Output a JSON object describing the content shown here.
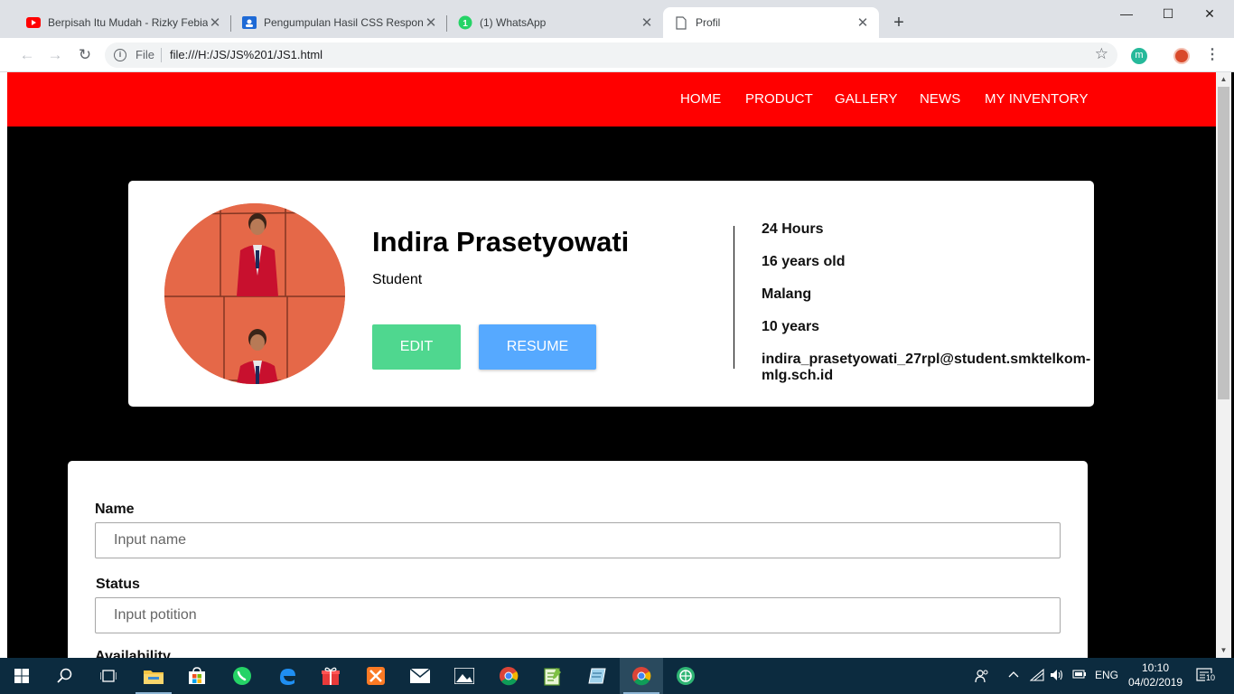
{
  "browser": {
    "tabs": [
      {
        "title": "Berpisah Itu Mudah - Rizky Febian",
        "icon": "youtube-icon"
      },
      {
        "title": "Pengumpulan Hasil CSS Responsi",
        "icon": "classroom-icon"
      },
      {
        "title": "(1) WhatsApp",
        "icon": "whatsapp-icon"
      },
      {
        "title": "Profil",
        "icon": "page-icon"
      }
    ],
    "close_glyph": "✕",
    "new_tab_glyph": "+",
    "window_controls": {
      "minimize": "—",
      "maximize": "☐",
      "close": "✕"
    },
    "address": {
      "scheme_label": "File",
      "url": "file:///H:/JS/JS%201/JS1.html"
    },
    "extension_initial": "m"
  },
  "navbar": {
    "links": [
      "HOME",
      "PRODUCT",
      "GALLERY",
      "NEWS",
      "MY INVENTORY"
    ],
    "color": "#ff0000"
  },
  "profile": {
    "name": "Indira Prasetyowati",
    "role": "Student",
    "edit_label": "EDIT",
    "resume_label": "RESUME",
    "details": [
      "24 Hours",
      "16 years old",
      "Malang",
      "10 years",
      "indira_prasetyowati_27rpl@student.smktelkom-",
      "mlg.sch.id"
    ]
  },
  "form": {
    "fields": [
      {
        "label": "Name",
        "placeholder": "Input name"
      },
      {
        "label": "Status",
        "placeholder": "Input potition"
      },
      {
        "label": "Availability"
      }
    ]
  },
  "taskbar": {
    "apps": [
      "start-icon",
      "search-icon",
      "task-view-icon",
      "file-explorer-icon",
      "store-icon",
      "whatsapp-icon",
      "edge-icon",
      "gift-icon",
      "xampp-icon",
      "mail-icon",
      "photos-icon",
      "chrome-icon",
      "notepad-icon",
      "app-icon",
      "chrome-icon",
      "browser-icon"
    ],
    "language": "ENG",
    "time": "10:10",
    "date": "04/02/2019",
    "notification_count": "10"
  },
  "colors": {
    "edit": "#4fd78f",
    "resume": "#56a9ff"
  }
}
